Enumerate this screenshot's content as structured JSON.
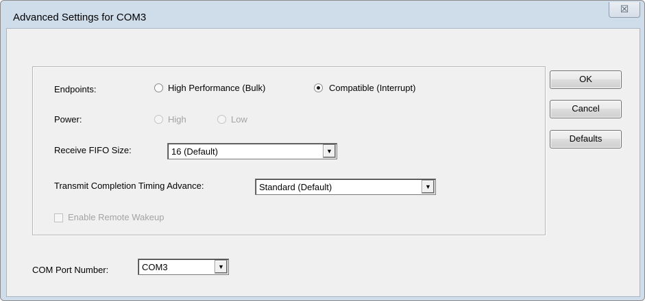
{
  "window": {
    "title": "Advanced Settings for COM3",
    "close_glyph": "☒"
  },
  "endpoints": {
    "label": "Endpoints:",
    "options": [
      {
        "label": "High Performance (Bulk)",
        "selected": false
      },
      {
        "label": "Compatible (Interrupt)",
        "selected": true
      }
    ]
  },
  "power": {
    "label": "Power:",
    "options": [
      {
        "label": "High",
        "enabled": false
      },
      {
        "label": "Low",
        "enabled": false
      }
    ]
  },
  "receive_fifo": {
    "label": "Receive FIFO Size:",
    "value": "16 (Default)"
  },
  "transmit_timing": {
    "label": "Transmit Completion Timing Advance:",
    "value": "Standard (Default)"
  },
  "remote_wakeup": {
    "label": "Enable Remote Wakeup",
    "checked": false,
    "enabled": false
  },
  "com_port": {
    "label": "COM Port Number:",
    "value": "COM3"
  },
  "buttons": {
    "ok": "OK",
    "cancel": "Cancel",
    "defaults": "Defaults"
  },
  "icons": {
    "dropdown": "▼"
  }
}
